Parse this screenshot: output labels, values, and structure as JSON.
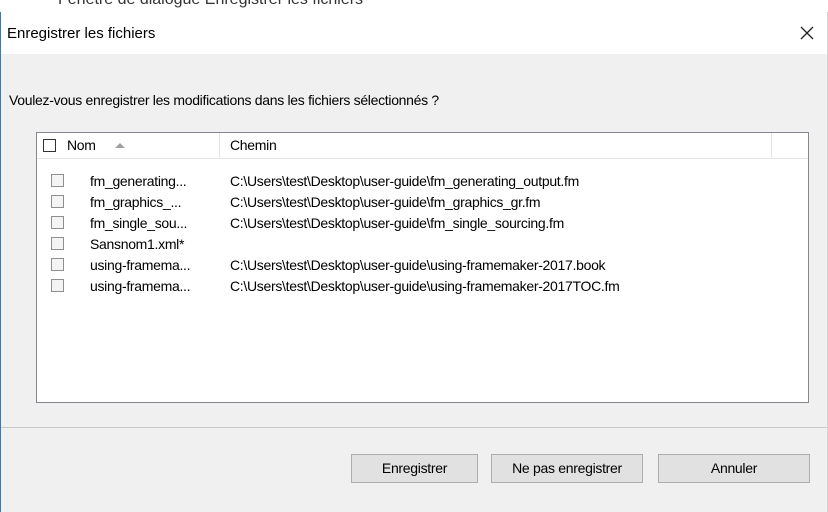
{
  "background_partial_text": "Fenêtre de dialogue Enregistrer les fichiers",
  "dialog": {
    "title": "Enregistrer les fichiers",
    "prompt": "Voulez-vous enregistrer les modifications dans les fichiers sélectionnés ?",
    "columns": {
      "name": "Nom",
      "path": "Chemin"
    },
    "rows": [
      {
        "name": "fm_generating...",
        "path": "C:\\Users\\test\\Desktop\\user-guide\\fm_generating_output.fm",
        "checked": false
      },
      {
        "name": "fm_graphics_...",
        "path": "C:\\Users\\test\\Desktop\\user-guide\\fm_graphics_gr.fm",
        "checked": false
      },
      {
        "name": "fm_single_sou...",
        "path": "C:\\Users\\test\\Desktop\\user-guide\\fm_single_sourcing.fm",
        "checked": false
      },
      {
        "name": "Sansnom1.xml*",
        "path": "",
        "checked": false
      },
      {
        "name": "using-framema...",
        "path": "C:\\Users\\test\\Desktop\\user-guide\\using-framemaker-2017.book",
        "checked": false
      },
      {
        "name": "using-framema...",
        "path": "C:\\Users\\test\\Desktop\\user-guide\\using-framemaker-2017TOC.fm",
        "checked": false
      }
    ],
    "buttons": {
      "save": "Enregistrer",
      "dont_save": "Ne pas enregistrer",
      "cancel": "Annuler"
    }
  },
  "colors": {
    "accent_border": "#2b79d9",
    "dialog_bg": "#f0f0f0",
    "button_bg": "#e1e1e1"
  }
}
